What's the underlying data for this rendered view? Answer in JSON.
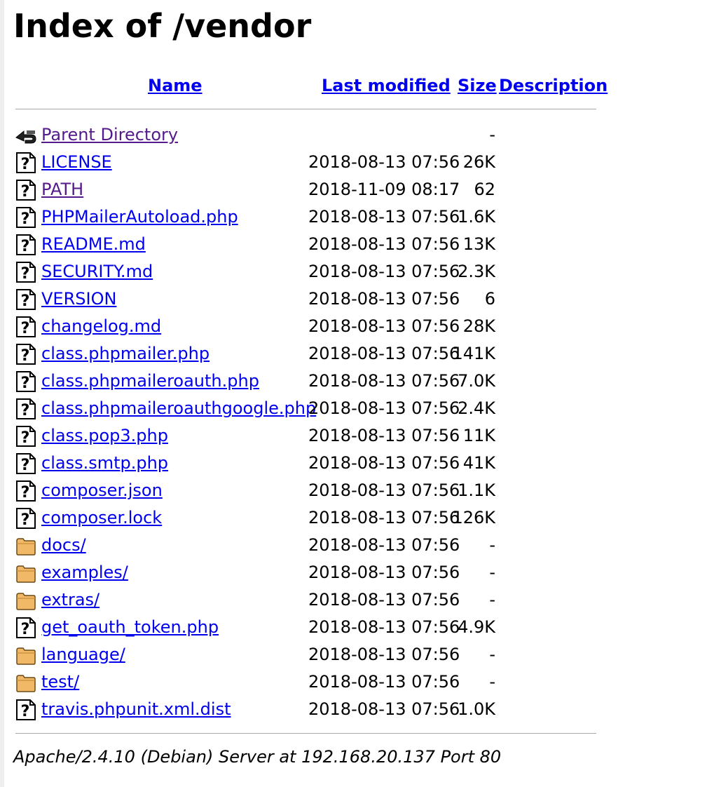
{
  "page": {
    "title": "Index of /vendor"
  },
  "columns": {
    "name": "Name",
    "last_modified": "Last modified",
    "size": "Size",
    "description": "Description"
  },
  "rows": [
    {
      "icon": "back-arrow-icon",
      "name": "Parent Directory",
      "date": "",
      "size": "-",
      "visited": true
    },
    {
      "icon": "unknown-file-icon",
      "name": "LICENSE",
      "date": "2018-08-13 07:56",
      "size": "26K"
    },
    {
      "icon": "unknown-file-icon",
      "name": "PATH",
      "date": "2018-11-09 08:17",
      "size": "62",
      "visited": true
    },
    {
      "icon": "unknown-file-icon",
      "name": "PHPMailerAutoload.php",
      "date": "2018-08-13 07:56",
      "size": "1.6K"
    },
    {
      "icon": "unknown-file-icon",
      "name": "README.md",
      "date": "2018-08-13 07:56",
      "size": "13K"
    },
    {
      "icon": "unknown-file-icon",
      "name": "SECURITY.md",
      "date": "2018-08-13 07:56",
      "size": "2.3K"
    },
    {
      "icon": "unknown-file-icon",
      "name": "VERSION",
      "date": "2018-08-13 07:56",
      "size": "6"
    },
    {
      "icon": "unknown-file-icon",
      "name": "changelog.md",
      "date": "2018-08-13 07:56",
      "size": "28K"
    },
    {
      "icon": "unknown-file-icon",
      "name": "class.phpmailer.php",
      "date": "2018-08-13 07:56",
      "size": "141K"
    },
    {
      "icon": "unknown-file-icon",
      "name": "class.phpmaileroauth.php",
      "date": "2018-08-13 07:56",
      "size": "7.0K"
    },
    {
      "icon": "unknown-file-icon",
      "name": "class.phpmaileroauthgoogle.php",
      "date": "2018-08-13 07:56",
      "size": "2.4K"
    },
    {
      "icon": "unknown-file-icon",
      "name": "class.pop3.php",
      "date": "2018-08-13 07:56",
      "size": "11K"
    },
    {
      "icon": "unknown-file-icon",
      "name": "class.smtp.php",
      "date": "2018-08-13 07:56",
      "size": "41K"
    },
    {
      "icon": "unknown-file-icon",
      "name": "composer.json",
      "date": "2018-08-13 07:56",
      "size": "1.1K"
    },
    {
      "icon": "unknown-file-icon",
      "name": "composer.lock",
      "date": "2018-08-13 07:56",
      "size": "126K"
    },
    {
      "icon": "folder-icon",
      "name": "docs/",
      "date": "2018-08-13 07:56",
      "size": "-"
    },
    {
      "icon": "folder-icon",
      "name": "examples/",
      "date": "2018-08-13 07:56",
      "size": "-"
    },
    {
      "icon": "folder-icon",
      "name": "extras/",
      "date": "2018-08-13 07:56",
      "size": "-"
    },
    {
      "icon": "unknown-file-icon",
      "name": "get_oauth_token.php",
      "date": "2018-08-13 07:56",
      "size": "4.9K"
    },
    {
      "icon": "folder-icon",
      "name": "language/",
      "date": "2018-08-13 07:56",
      "size": "-"
    },
    {
      "icon": "folder-icon",
      "name": "test/",
      "date": "2018-08-13 07:56",
      "size": "-"
    },
    {
      "icon": "unknown-file-icon",
      "name": "travis.phpunit.xml.dist",
      "date": "2018-08-13 07:56",
      "size": "1.0K"
    }
  ],
  "footer": {
    "signature": "Apache/2.4.10 (Debian) Server at 192.168.20.137 Port 80"
  },
  "colors": {
    "link": "#0000ee",
    "visited_link": "#551a8b",
    "rule": "#a8a8a8",
    "folder": "#f0b867"
  }
}
